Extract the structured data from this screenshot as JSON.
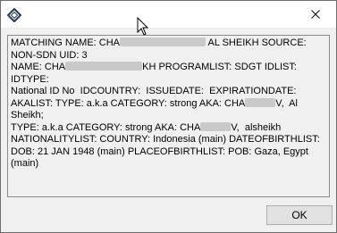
{
  "window": {
    "title": "",
    "close_icon": "close-icon",
    "app_icon": "diamond-app-icon"
  },
  "details": {
    "lines": [
      "MATCHING NAME: CHA",
      " AL SHEIKH SOURCE: NON-SDN UID: 3",
      "NAME: CHA",
      "KH PROGRAMLIST: SDGT IDLIST: IDTYPE:",
      "National ID No  IDCOUNTRY:  ISSUEDATE:  EXPIRATIONDATE:",
      "AKALIST: TYPE: a.k.a CATEGORY: strong AKA: CHA",
      "V,  Al Sheikh;",
      "TYPE: a.k.a CATEGORY: strong AKA: CHA",
      "V,  alsheikh",
      "NATIONALITYLIST: COUNTRY: Indonesia (main) DATEOFBIRTHLIST:",
      "DOB: 21 JAN 1948 (main) PLACEOFBIRTHLIST: POB: Gaza, Egypt (main)"
    ]
  },
  "buttons": {
    "ok_label": "OK"
  },
  "colors": {
    "dialog_bg": "#f0f0f0",
    "title_bg": "#ffffff",
    "button_bg": "#e1e1e1",
    "button_border": "#adadad"
  }
}
